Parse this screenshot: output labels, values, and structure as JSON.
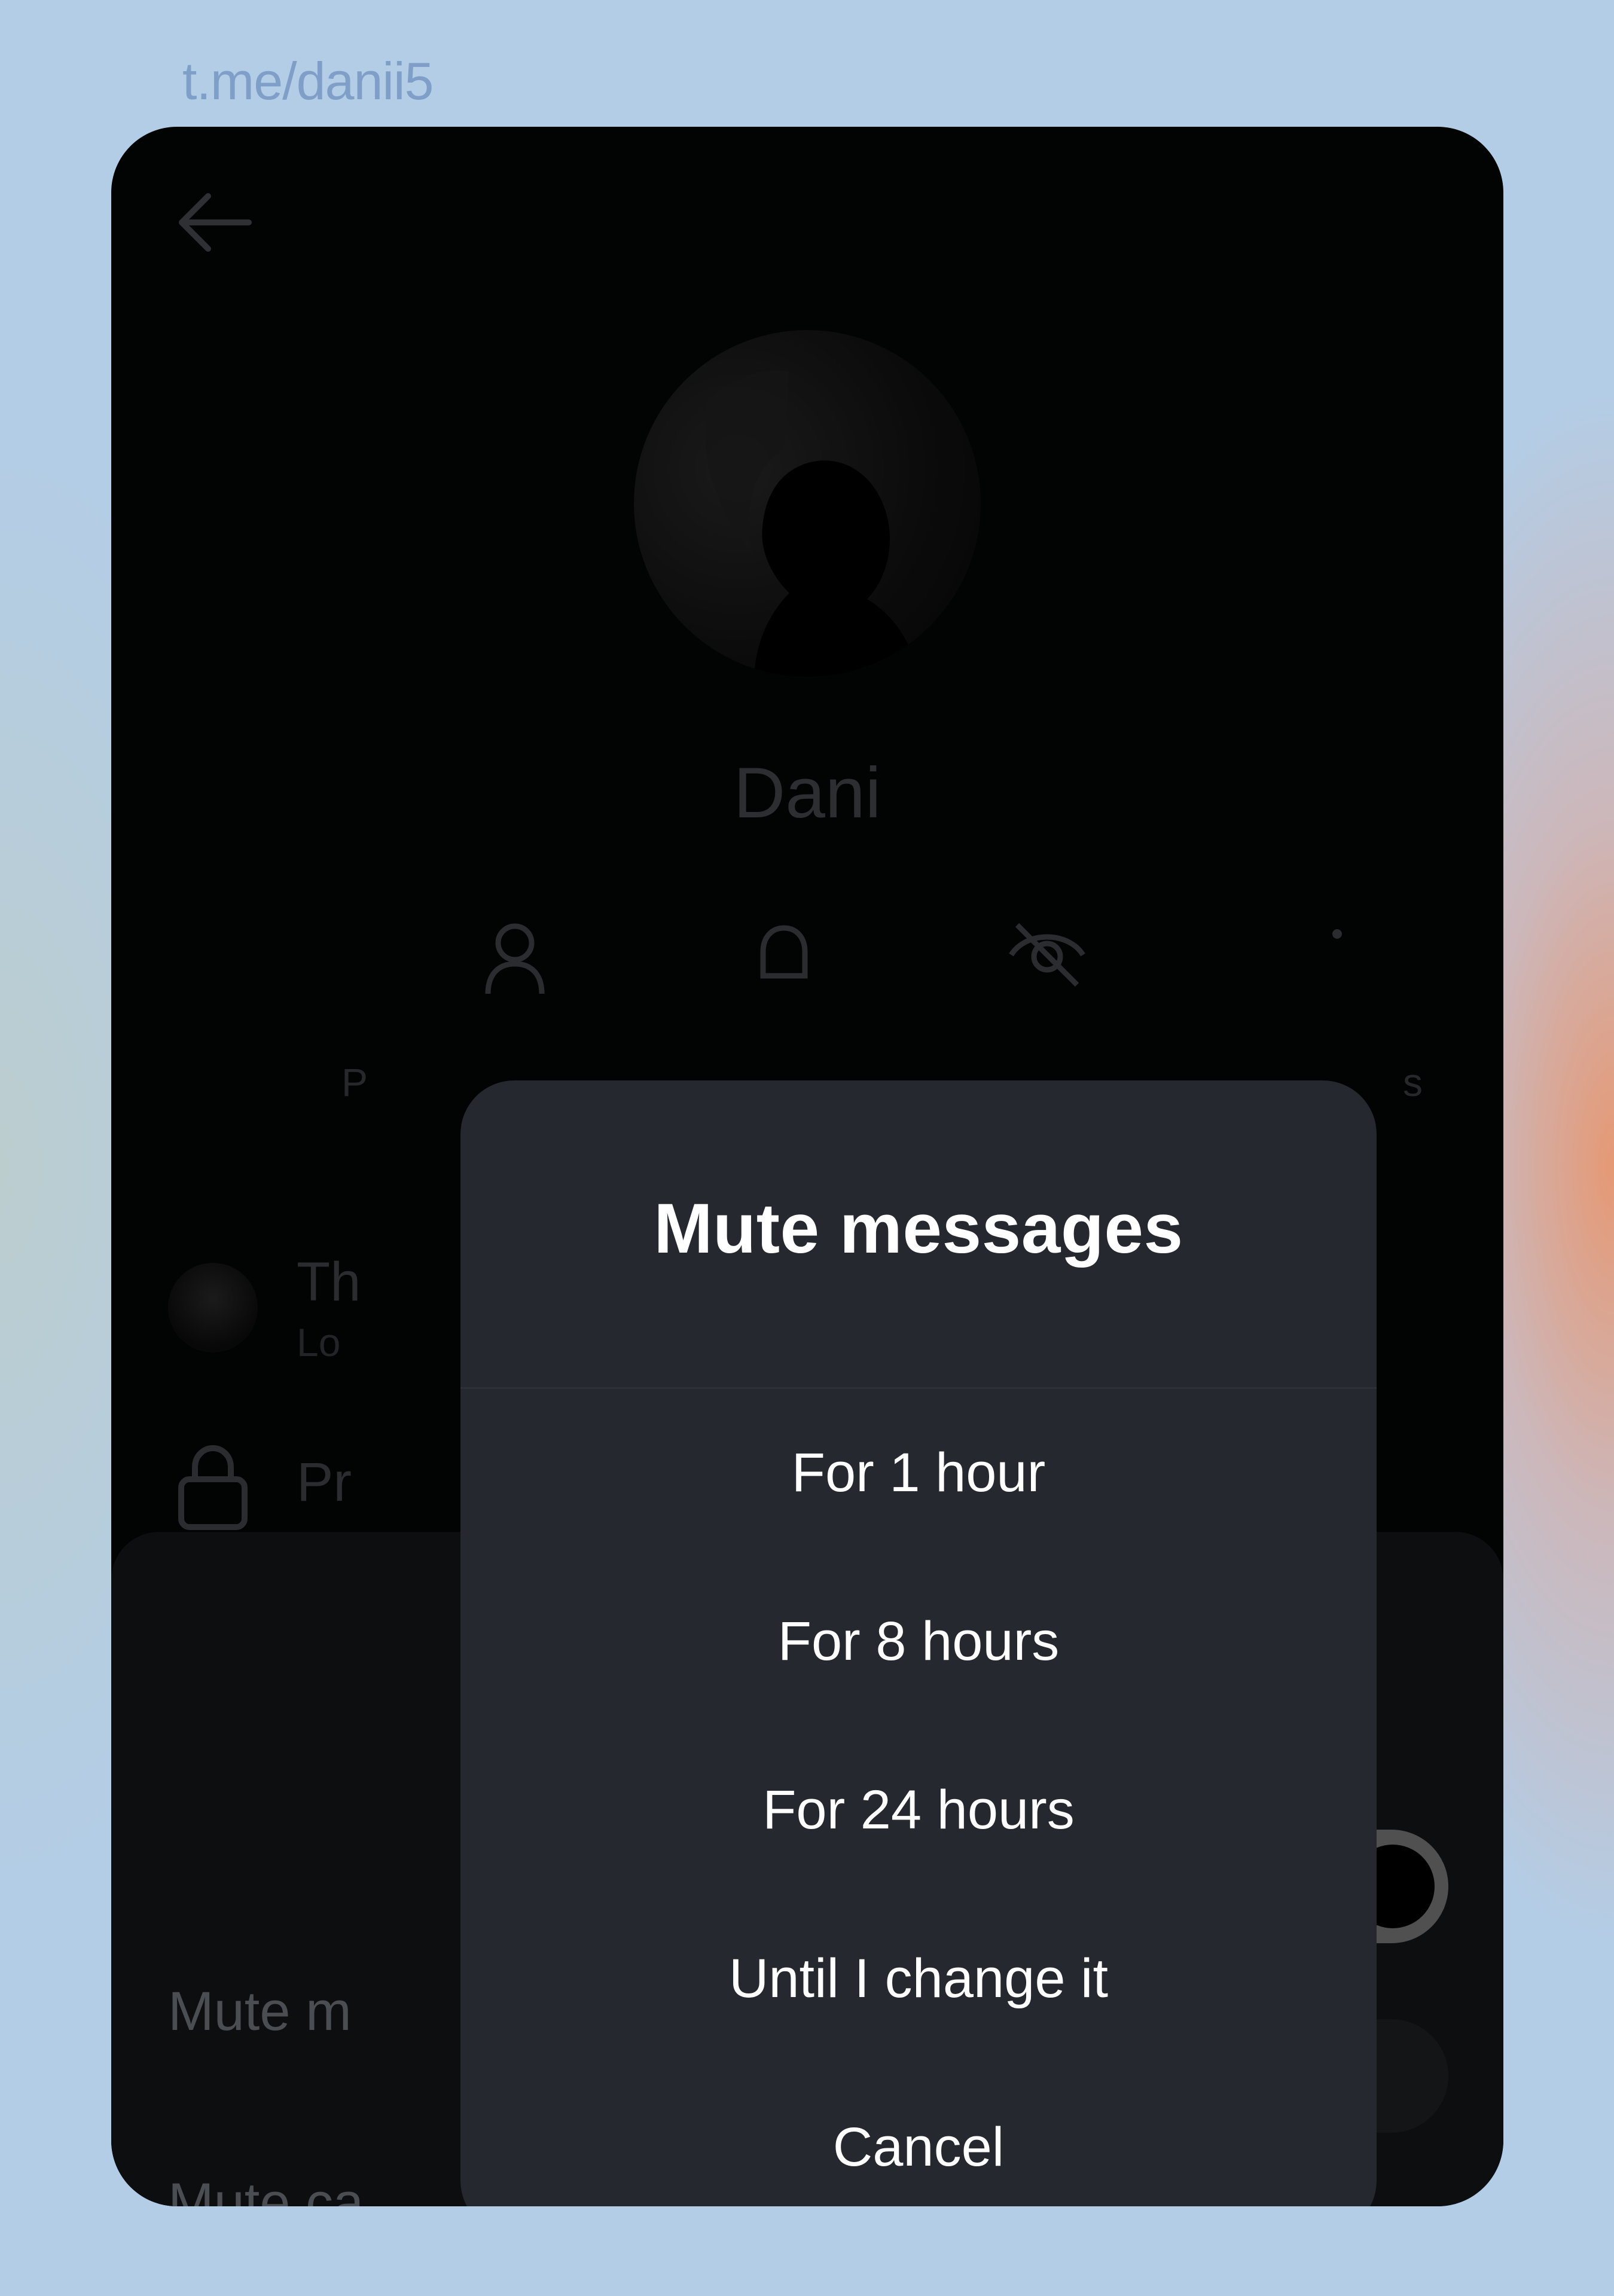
{
  "watermark": "t.me/danii5",
  "profile": {
    "name": "Dani",
    "actions": [
      {
        "icon": "profile-icon",
        "label": "P"
      },
      {
        "icon": "bell-icon",
        "label": ""
      },
      {
        "icon": "eye-off-icon",
        "label": ""
      },
      {
        "icon": "more-icon",
        "label": "s"
      }
    ]
  },
  "rows": {
    "theme_title": "Th",
    "theme_sub": "Lo",
    "privacy_label": "Pr"
  },
  "sheet": {
    "mute_messages_label": "Mute m",
    "mute_calls_label": "Mute ca",
    "mute_messages_on": true,
    "mute_calls_on": false
  },
  "dialog": {
    "title": "Mute messages",
    "options": [
      "For 1 hour",
      "For 8 hours",
      "For 24 hours",
      "Until I change it"
    ],
    "cancel": "Cancel"
  },
  "colors": {
    "background": "#b3cde6",
    "screen": "#020303",
    "dialog": "#25282e",
    "toggle_on": "#505050"
  }
}
